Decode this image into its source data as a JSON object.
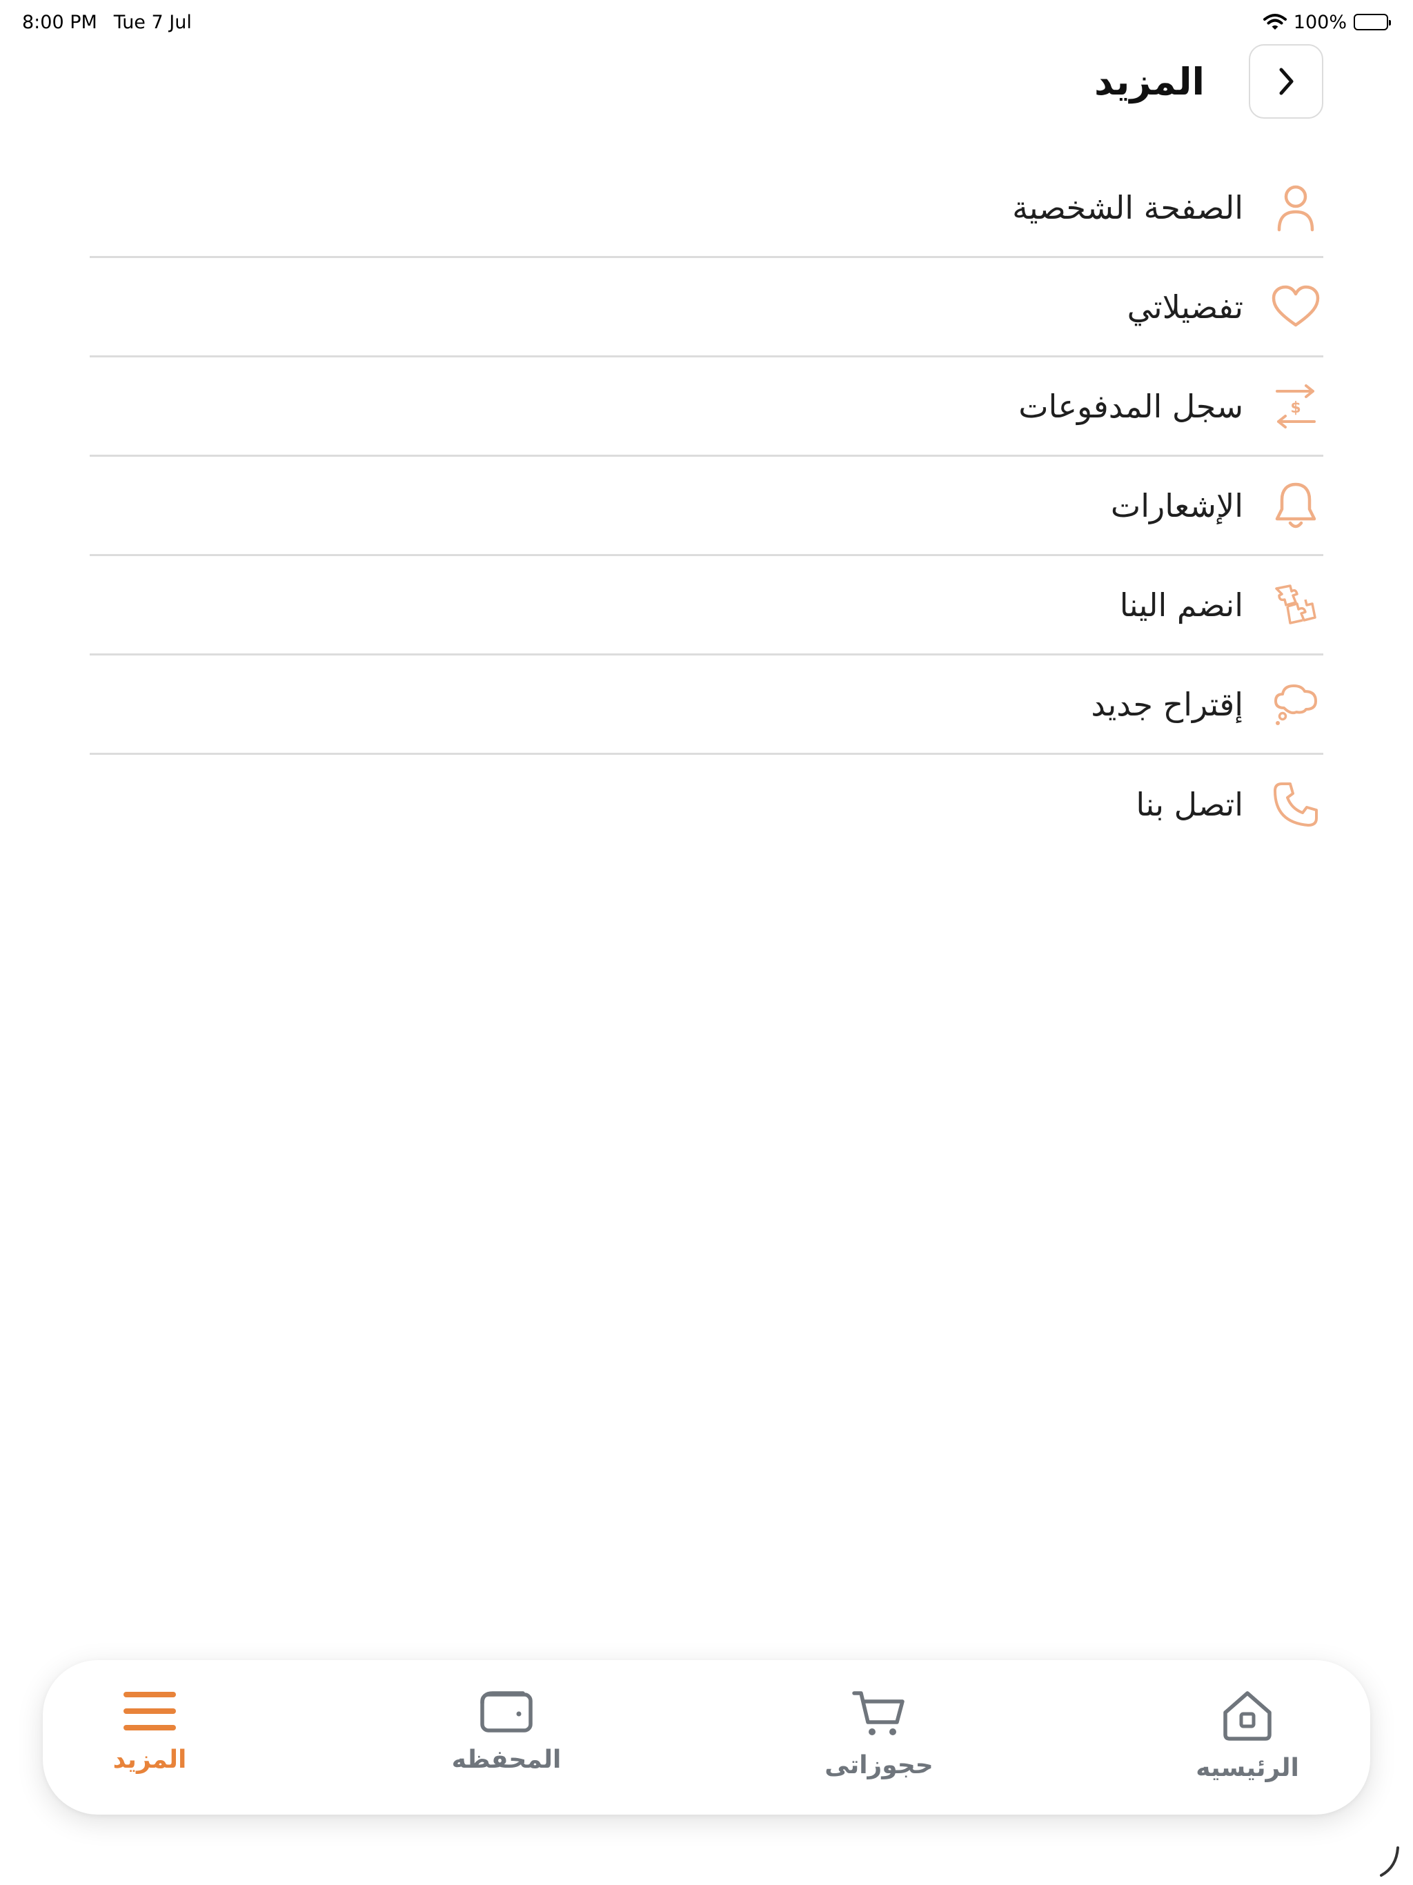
{
  "status_bar": {
    "time": "8:00 PM",
    "date": "Tue 7 Jul",
    "battery": "100%"
  },
  "header": {
    "title": "المزيد",
    "back_icon": "chevron-right-icon"
  },
  "colors": {
    "accent": "#e8833a",
    "icon_accent": "#f0ae86",
    "tab_inactive": "#6f757c",
    "divider": "#dcdcdc"
  },
  "menu": {
    "items": [
      {
        "label": "الصفحة الشخصية",
        "icon": "user-icon"
      },
      {
        "label": "تفضيلاتي",
        "icon": "heart-icon"
      },
      {
        "label": "سجل المدفوعات",
        "icon": "payment-transfer-icon"
      },
      {
        "label": "الإشعارات",
        "icon": "bell-icon"
      },
      {
        "label": "انضم الينا",
        "icon": "puzzle-icon"
      },
      {
        "label": "إقتراح جديد",
        "icon": "thought-bubble-icon"
      },
      {
        "label": "اتصل بنا",
        "icon": "phone-icon"
      }
    ]
  },
  "tab_bar": {
    "active": "المزيد",
    "tabs": [
      {
        "label": "الرئيسيه",
        "icon": "home-icon"
      },
      {
        "label": "حجوزاتى",
        "icon": "cart-icon"
      },
      {
        "label": "المحفظه",
        "icon": "wallet-icon"
      },
      {
        "label": "المزيد",
        "icon": "menu-icon"
      }
    ]
  }
}
